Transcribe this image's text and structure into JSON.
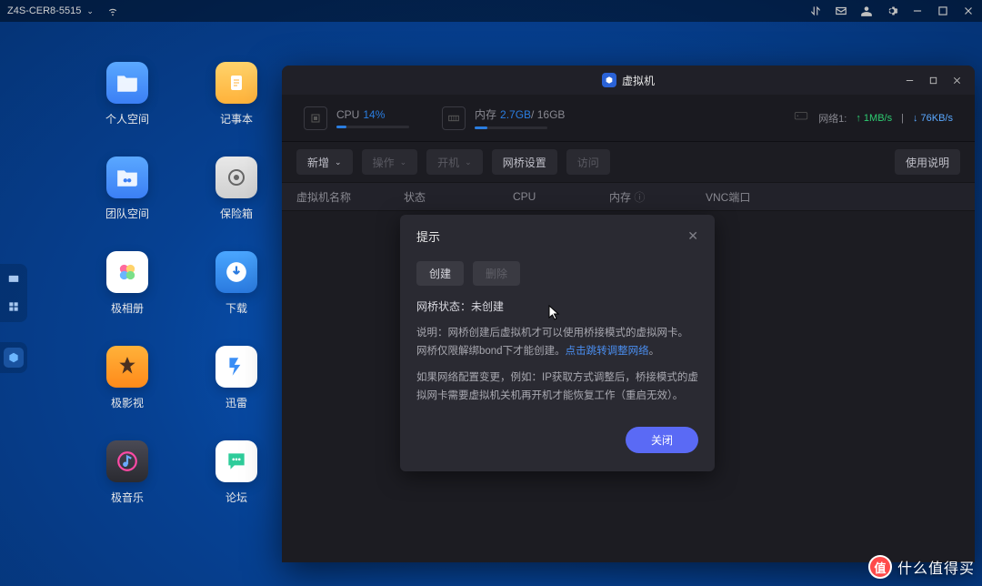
{
  "topbar": {
    "hostname": "Z4S-CER8-5515"
  },
  "desktop": {
    "items": [
      {
        "label": "个人空间",
        "cls": "t-folder"
      },
      {
        "label": "记事本",
        "cls": "t-note"
      },
      {
        "label": "团队空间",
        "cls": "t-team"
      },
      {
        "label": "保险箱",
        "cls": "t-safe"
      },
      {
        "label": "极相册",
        "cls": "t-photo"
      },
      {
        "label": "下载",
        "cls": "t-dl"
      },
      {
        "label": "极影视",
        "cls": "t-video"
      },
      {
        "label": "迅雷",
        "cls": "t-xl"
      },
      {
        "label": "极音乐",
        "cls": "t-music"
      },
      {
        "label": "论坛",
        "cls": "t-forum"
      }
    ]
  },
  "vm": {
    "title": "虚拟机",
    "stats": {
      "cpu_label": "CPU",
      "cpu_value": "14%",
      "cpu_pct": 14,
      "mem_label": "内存",
      "mem_value": "2.7GB",
      "mem_max": "/ 16GB",
      "mem_pct": 17,
      "net_label": "网络1:",
      "net_up": "↑ 1MB/s",
      "net_down": "↓ 76KB/s"
    },
    "toolbar": {
      "add": "新增",
      "ops": "操作",
      "boot": "开机",
      "bridge": "网桥设置",
      "visit": "访问",
      "help": "使用说明"
    },
    "columns": {
      "name": "虚拟机名称",
      "state": "状态",
      "cpu": "CPU",
      "mem": "内存",
      "vnc": "VNC端口"
    }
  },
  "modal": {
    "title": "提示",
    "tab_create": "创建",
    "tab_delete": "删除",
    "status_label": "网桥状态：",
    "status_value": "未创建",
    "desc_prefix": "说明：",
    "desc_line1a": "网桥创建后虚拟机才可以使用桥接模式的虚拟网卡。网桥仅限解绑bond下才能创建。",
    "desc_link": "点击跳转调整网络",
    "desc_line1b": "。",
    "desc_line2": "如果网络配置变更，例如：IP获取方式调整后，桥接模式的虚拟网卡需要虚拟机关机再开机才能恢复工作（重启无效）。",
    "close": "关闭"
  },
  "watermark": {
    "badge": "值",
    "text": "什么值得买"
  }
}
